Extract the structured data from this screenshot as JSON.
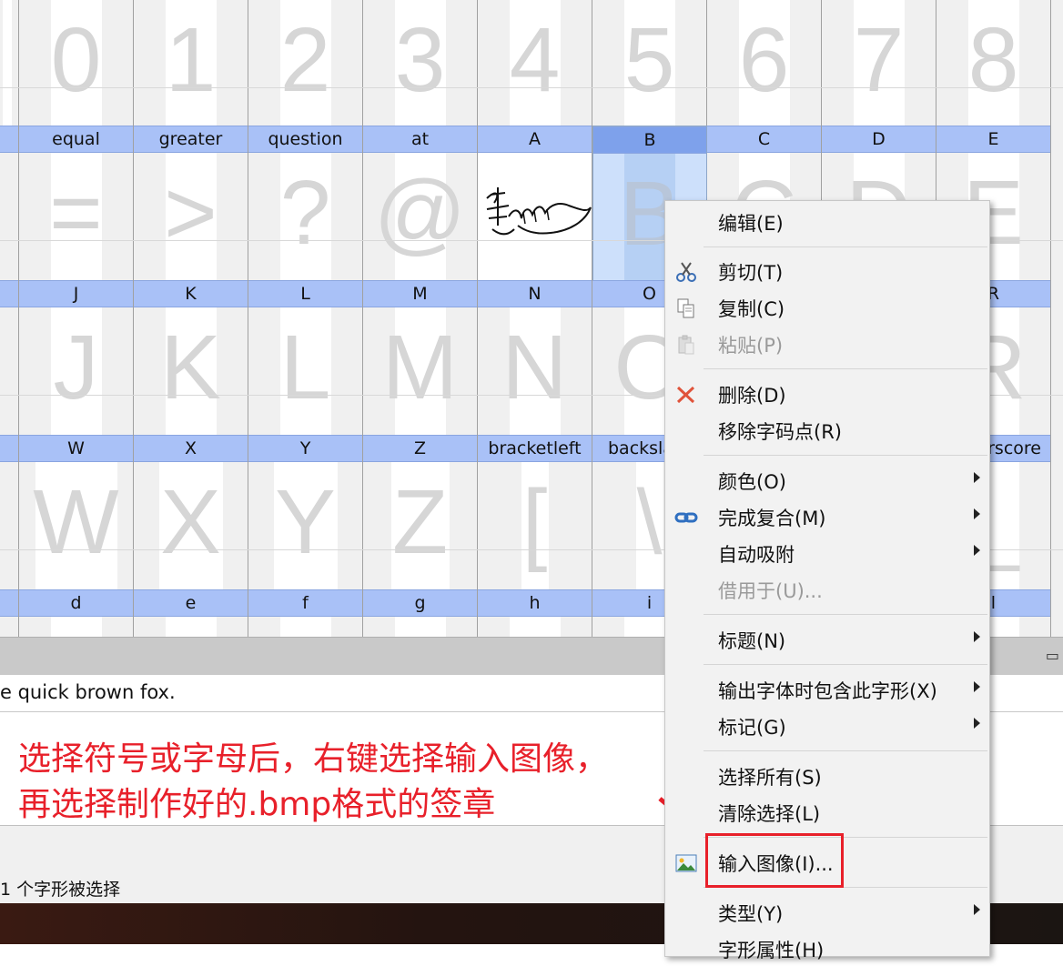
{
  "grid": {
    "row0": {
      "glyphs": [
        "0",
        "1",
        "2",
        "3",
        "4",
        "5",
        "6",
        "7",
        "8"
      ]
    },
    "row1": {
      "names": [
        "equal",
        "greater",
        "question",
        "at",
        "A",
        "B",
        "C",
        "D",
        "E"
      ],
      "glyphs": [
        "=",
        ">",
        "?",
        "@",
        "",
        "B",
        "C",
        "D",
        "E"
      ]
    },
    "row2": {
      "names": [
        "J",
        "K",
        "L",
        "M",
        "N",
        "O",
        "",
        "",
        "R"
      ],
      "glyphs": [
        "J",
        "K",
        "L",
        "M",
        "N",
        "O",
        "",
        "",
        "R"
      ]
    },
    "row3": {
      "names": [
        "W",
        "X",
        "Y",
        "Z",
        "bracketleft",
        "backsla",
        "",
        "",
        "rscore"
      ],
      "glyphs": [
        "W",
        "X",
        "Y",
        "Z",
        "[",
        "\\",
        "",
        "",
        "_"
      ]
    },
    "row4": {
      "names": [
        "d",
        "e",
        "f",
        "g",
        "h",
        "i",
        "",
        "",
        "l"
      ]
    }
  },
  "preview_text": "e quick brown fox.",
  "annotation": {
    "line1": "选择符号或字母后，右键选择输入图像，",
    "line2": "再选择制作好的.bmp格式的签章"
  },
  "status": "1 个字形被选择",
  "menu": {
    "edit": "编辑(E)",
    "cut": "剪切(T)",
    "copy": "复制(C)",
    "paste": "粘贴(P)",
    "delete": "删除(D)",
    "remove_codepoint": "移除字码点(R)",
    "color": "颜色(O)",
    "finish_composite": "完成复合(M)",
    "auto_snap": "自动吸附",
    "borrow": "借用于(U)...",
    "title": "标题(N)",
    "include_on_export": "输出字体时包含此字形(X)",
    "mark": "标记(G)",
    "select_all": "选择所有(S)",
    "clear_selection": "清除选择(L)",
    "import_image": "输入图像(I)...",
    "type": "类型(Y)",
    "glyph_props": "字形属性(H)"
  },
  "colors": {
    "header": "#a9c1f7",
    "accent_red": "#e8202a",
    "selected": "#cde0fb"
  }
}
